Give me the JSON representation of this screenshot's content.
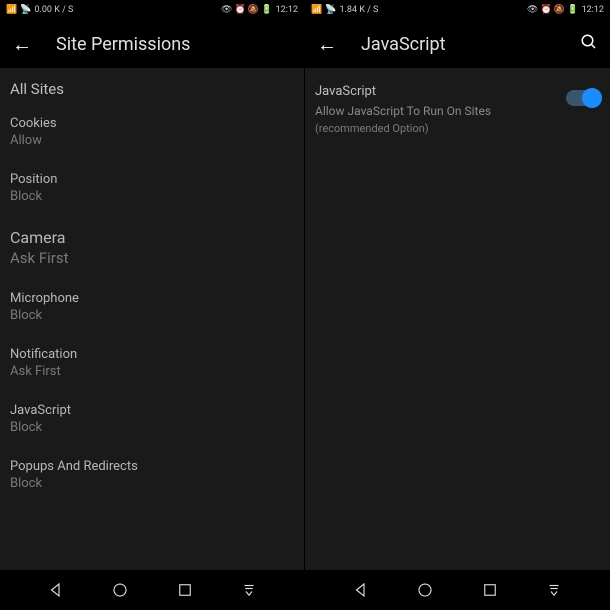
{
  "status": {
    "left_speed": "0.00 K / S",
    "right_speed": "1.84 K / S",
    "time": "12:12",
    "right_icons": "⚬ ⏰ ⊘ 🔋"
  },
  "left_screen": {
    "title": "Site Permissions",
    "section": "All Sites",
    "items": [
      {
        "label": "Cookies",
        "value": "Allow"
      },
      {
        "label": "Position",
        "value": "Block"
      },
      {
        "label": "Camera",
        "value": "Ask First"
      },
      {
        "label": "Microphone",
        "value": "Block"
      },
      {
        "label": "Notification",
        "value": "Ask First"
      },
      {
        "label": "JavaScript",
        "value": "Block"
      },
      {
        "label": "Popups And Redirects",
        "value": "Block"
      }
    ]
  },
  "right_screen": {
    "title": "JavaScript",
    "js_title": "JavaScript",
    "js_desc": "Allow JavaScript To Run On Sites",
    "js_note": "(recommended Option)",
    "toggle_on": true
  }
}
